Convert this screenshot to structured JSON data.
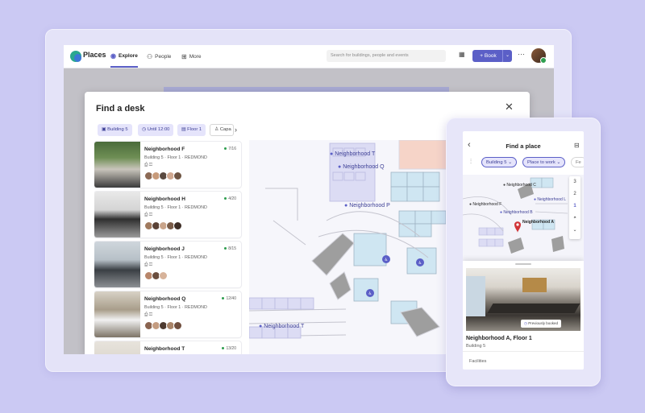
{
  "app": {
    "name": "Places"
  },
  "nav": [
    {
      "label": "Explore",
      "icon": "compass-icon",
      "active": true
    },
    {
      "label": "People",
      "icon": "people-icon",
      "active": false
    },
    {
      "label": "More",
      "icon": "apps-grid-icon",
      "active": false
    }
  ],
  "search": {
    "placeholder": "Search for buildings, people and events"
  },
  "header": {
    "book_label": "Book",
    "book_icon": "+",
    "more_icon": "···"
  },
  "panel": {
    "title": "Find a desk",
    "filters": [
      {
        "label": "Building 5",
        "icon": "building-icon"
      },
      {
        "label": "Until 12:00",
        "icon": "clock-icon"
      },
      {
        "label": "Floor 1",
        "icon": "floor-icon"
      },
      {
        "label": "Capa",
        "icon": "person-icon"
      }
    ]
  },
  "neighborhoods": [
    {
      "name": "Neighborhood F",
      "count": "7/16",
      "location": "Building 5 · Floor 1 · REDMOND",
      "amenities": "⎙ ◫",
      "photo": "linear-gradient(180deg,#4a6b3a 0%,#6f8f55 35%,#c9c5bc 60%,#3b3b3b 100%)"
    },
    {
      "name": "Neighborhood H",
      "count": "4/20",
      "location": "Building 5 · Floor 1 · REDMOND",
      "amenities": "⎙ ◫",
      "photo": "linear-gradient(180deg,#e9e9e9 0%,#d4d4d4 40%,#2f2f2f 60%,#9a9a9a 100%)"
    },
    {
      "name": "Neighborhood J",
      "count": "8/15",
      "location": "Building 5 · Floor 1 · REDMOND",
      "amenities": "⎙ ◫",
      "photo": "linear-gradient(180deg,#cfd6dc 0%,#b7c0c7 40%,#3a3f44 62%,#8c8f93 100%)"
    },
    {
      "name": "Neighborhood Q",
      "count": "12/40",
      "location": "Building 5 · Floor 1 · REDMOND",
      "amenities": "⎙ ◫",
      "photo": "linear-gradient(180deg,#d8d2c6 0%,#a89d8a 40%,#f1f1f1 62%,#7d7466 100%)"
    },
    {
      "name": "Neighborhood T",
      "count": "13/20",
      "location": "",
      "amenities": "",
      "photo": "linear-gradient(180deg,#e7e3dc 0%,#cfc7ba 100%)"
    }
  ],
  "map_labels": [
    "Neighborhood T",
    "Neighborhood Q",
    "Neighborhood P",
    "Neighborhood T"
  ],
  "phone": {
    "title": "Find a place",
    "filters": [
      {
        "label": "Building 5 ⌄"
      },
      {
        "label": "Place to work ⌄"
      },
      {
        "label": "Fe"
      }
    ],
    "map_labels": [
      "Neighborhood C",
      "Neighborhood L",
      "Neighborhood F",
      "Neighborhood B",
      "Neighborhood A"
    ],
    "floors": [
      "3",
      "2",
      "1"
    ],
    "selected": {
      "name": "Neighborhood A, Floor 1",
      "building": "Building 5",
      "badge": "Previously booked"
    },
    "facilities_label": "Facilities"
  },
  "colors": {
    "accent": "#5b5fc7",
    "background": "#cbc9f3",
    "available": "#2e9e4f"
  }
}
